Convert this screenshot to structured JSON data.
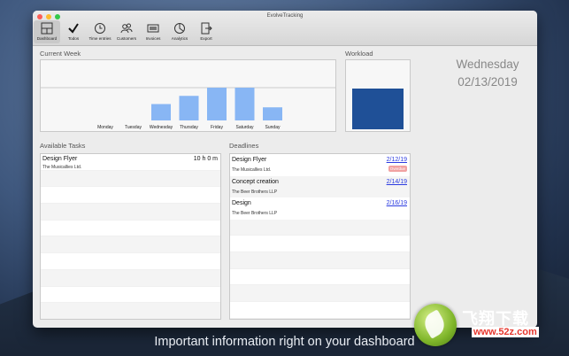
{
  "window": {
    "title": "EvolveTracking"
  },
  "toolbar": [
    {
      "label": "Dashboard",
      "icon": "dashboard-icon",
      "active": true
    },
    {
      "label": "Todos",
      "icon": "checkmark-icon",
      "active": false
    },
    {
      "label": "Time entries",
      "icon": "clock-icon",
      "active": false
    },
    {
      "label": "Customers",
      "icon": "customers-icon",
      "active": false
    },
    {
      "label": "Invoices",
      "icon": "invoice-icon",
      "active": false
    },
    {
      "label": "Analytics",
      "icon": "analytics-icon",
      "active": false
    },
    {
      "label": "Export",
      "icon": "export-icon",
      "active": false
    }
  ],
  "sections": {
    "current_week": "Current Week",
    "workload": "Workload",
    "available_tasks": "Available Tasks",
    "deadlines": "Deadlines"
  },
  "today": {
    "weekday": "Wednesday",
    "date": "02/13/2019"
  },
  "chart_data": {
    "type": "bar",
    "categories": [
      "Monday",
      "Tuesday",
      "Wednesday",
      "Thursday",
      "Friday",
      "Saturday",
      "Sunday"
    ],
    "values": [
      0,
      0,
      0.5,
      0.75,
      1.0,
      1.0,
      0.4
    ],
    "ylim": [
      0,
      1.0
    ],
    "grid": true,
    "bar_color": "#88b6f4"
  },
  "workload": {
    "fill_fraction": 0.6,
    "color": "#1f5097"
  },
  "available_tasks": [
    {
      "title": "Design Flyer",
      "hours": "10 h 0 m",
      "customer": "The Musicallies Ltd."
    }
  ],
  "deadlines": [
    {
      "title": "Design Flyer",
      "date": "2/12/19",
      "customer": "The Musicallies Ltd.",
      "badge": "Overdue"
    },
    {
      "title": "Concept creation",
      "date": "2/14/19",
      "customer": "The Beer Brothers LLP",
      "badge": ""
    },
    {
      "title": "Design",
      "date": "2/16/19",
      "customer": "The Beer Brothers LLP",
      "badge": ""
    }
  ],
  "caption": "Important information right on your dashboard",
  "watermark": {
    "brand": "飞翔下载",
    "url": "www.52z.com"
  }
}
